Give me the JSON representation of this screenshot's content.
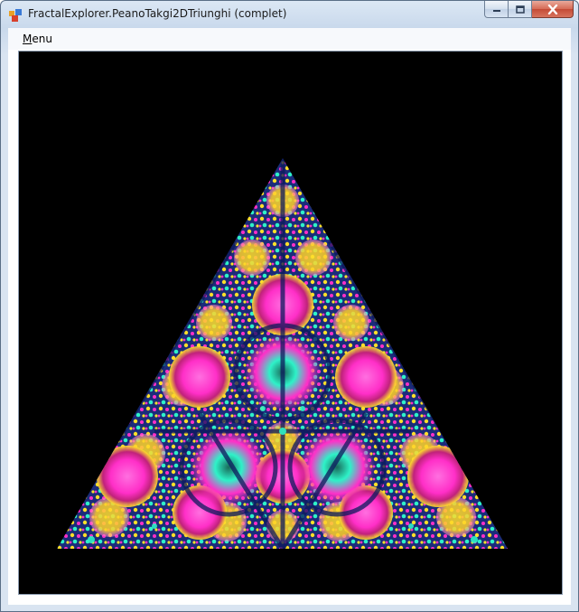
{
  "window": {
    "title": "FractalExplorer.PeanoTakgi2DTriunghi (complet)"
  },
  "menu": {
    "items": [
      {
        "label": "Menu",
        "underline": "M",
        "rest": "enu"
      }
    ]
  },
  "canvas": {
    "background": "#000000",
    "fractal_colors": [
      "#ff2fc8",
      "#ffe02a",
      "#2ef2c8",
      "#1a2f8a",
      "#8a1c3a",
      "#b07a2a"
    ]
  },
  "icons": {
    "app": "fractal-app-icon",
    "minimize": "minimize-icon",
    "maximize": "maximize-icon",
    "close": "close-icon"
  }
}
